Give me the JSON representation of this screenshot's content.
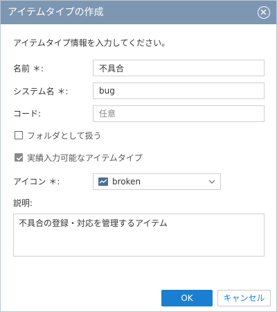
{
  "dialog": {
    "title": "アイテムタイプの作成",
    "instruction": "アイテムタイプ情報を入力してください。"
  },
  "form": {
    "name_label": "名前 ＊:",
    "name_value": "不具合",
    "system_name_label": "システム名 ＊:",
    "system_name_value": "bug",
    "code_label": "コード:",
    "code_placeholder": "任意",
    "folder_checkbox_label": "フォルダとして扱う",
    "folder_checked": false,
    "actual_input_checkbox_label": "実績入力可能なアイテムタイプ",
    "actual_input_checked": true,
    "icon_label": "アイコン ＊:",
    "icon_value": "broken",
    "icon_name": "broken-line-icon",
    "description_label": "説明:",
    "description_value": "不具合の登録・対応を管理するアイテム"
  },
  "buttons": {
    "ok_label": "OK",
    "cancel_label": "キャンセル"
  },
  "colors": {
    "titlebar": "#7d96b2",
    "primary": "#1a7fd0"
  }
}
